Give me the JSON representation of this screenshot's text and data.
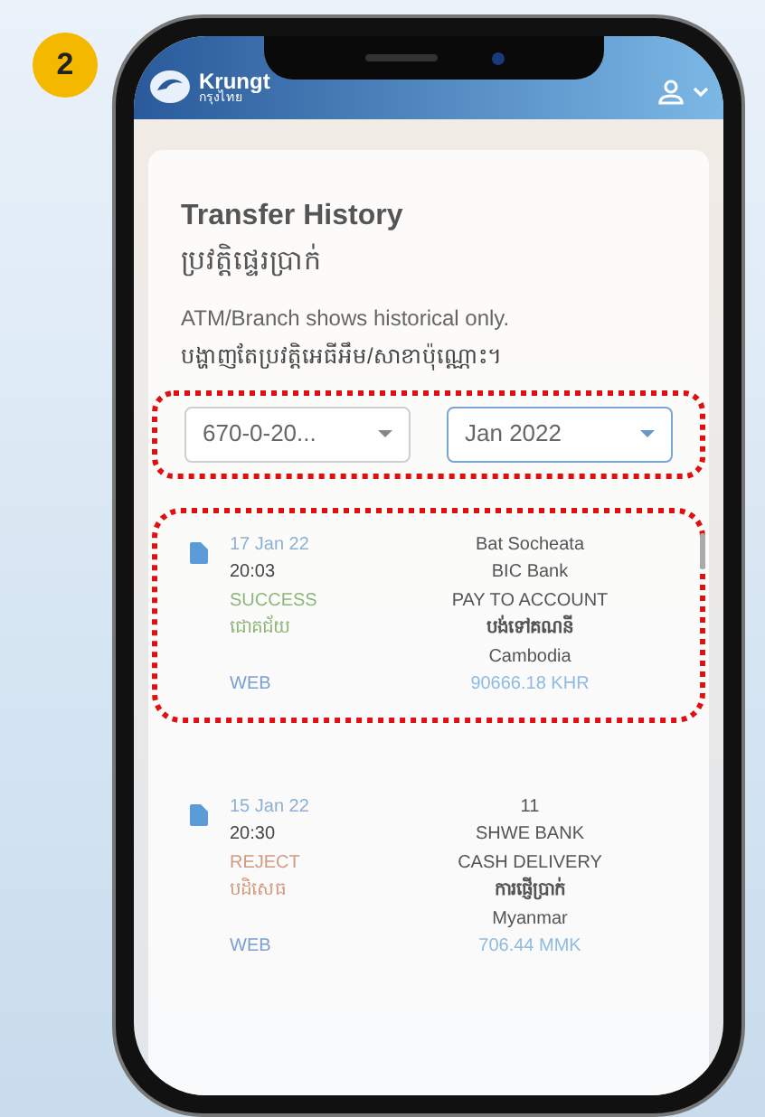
{
  "step_badge": "2",
  "header": {
    "brand": "Krungt",
    "brand_sub": "กรุงไทย"
  },
  "page": {
    "title": "Transfer History",
    "title_km": "ប្រវត្តិផ្ទេរប្រាក់",
    "note": "ATM/Branch shows historical only.",
    "note_km": "បង្ហាញតែប្រវត្តិអេធីអឹម/សាខាប៉ុណ្ណោះ។"
  },
  "filters": {
    "highlighted": true,
    "account": {
      "value": "670-0-20...",
      "selected": false
    },
    "month": {
      "value": "Jan 2022",
      "selected": true
    }
  },
  "records": [
    {
      "highlighted": true,
      "date": "17 Jan 22",
      "time": "20:03",
      "status": "SUCCESS",
      "status_km": "ជោគជ័យ",
      "color": "#8db67a",
      "channel": "WEB",
      "name": "Bat Socheata",
      "bank": "BIC Bank",
      "type": "PAY TO ACCOUNT",
      "type_km": "បង់ទៅគណនី",
      "country": "Cambodia",
      "amount": "90666.18 KHR"
    },
    {
      "highlighted": false,
      "date": "15 Jan 22",
      "time": "20:30",
      "status": "REJECT",
      "status_km": "បដិសេធ",
      "color": "#d49a80",
      "channel": "WEB",
      "name": "11",
      "bank": "SHWE BANK",
      "type": "CASH DELIVERY",
      "type_km": "ការផ្ញើប្រាក់",
      "country": "Myanmar",
      "amount": "706.44 MMK"
    }
  ]
}
